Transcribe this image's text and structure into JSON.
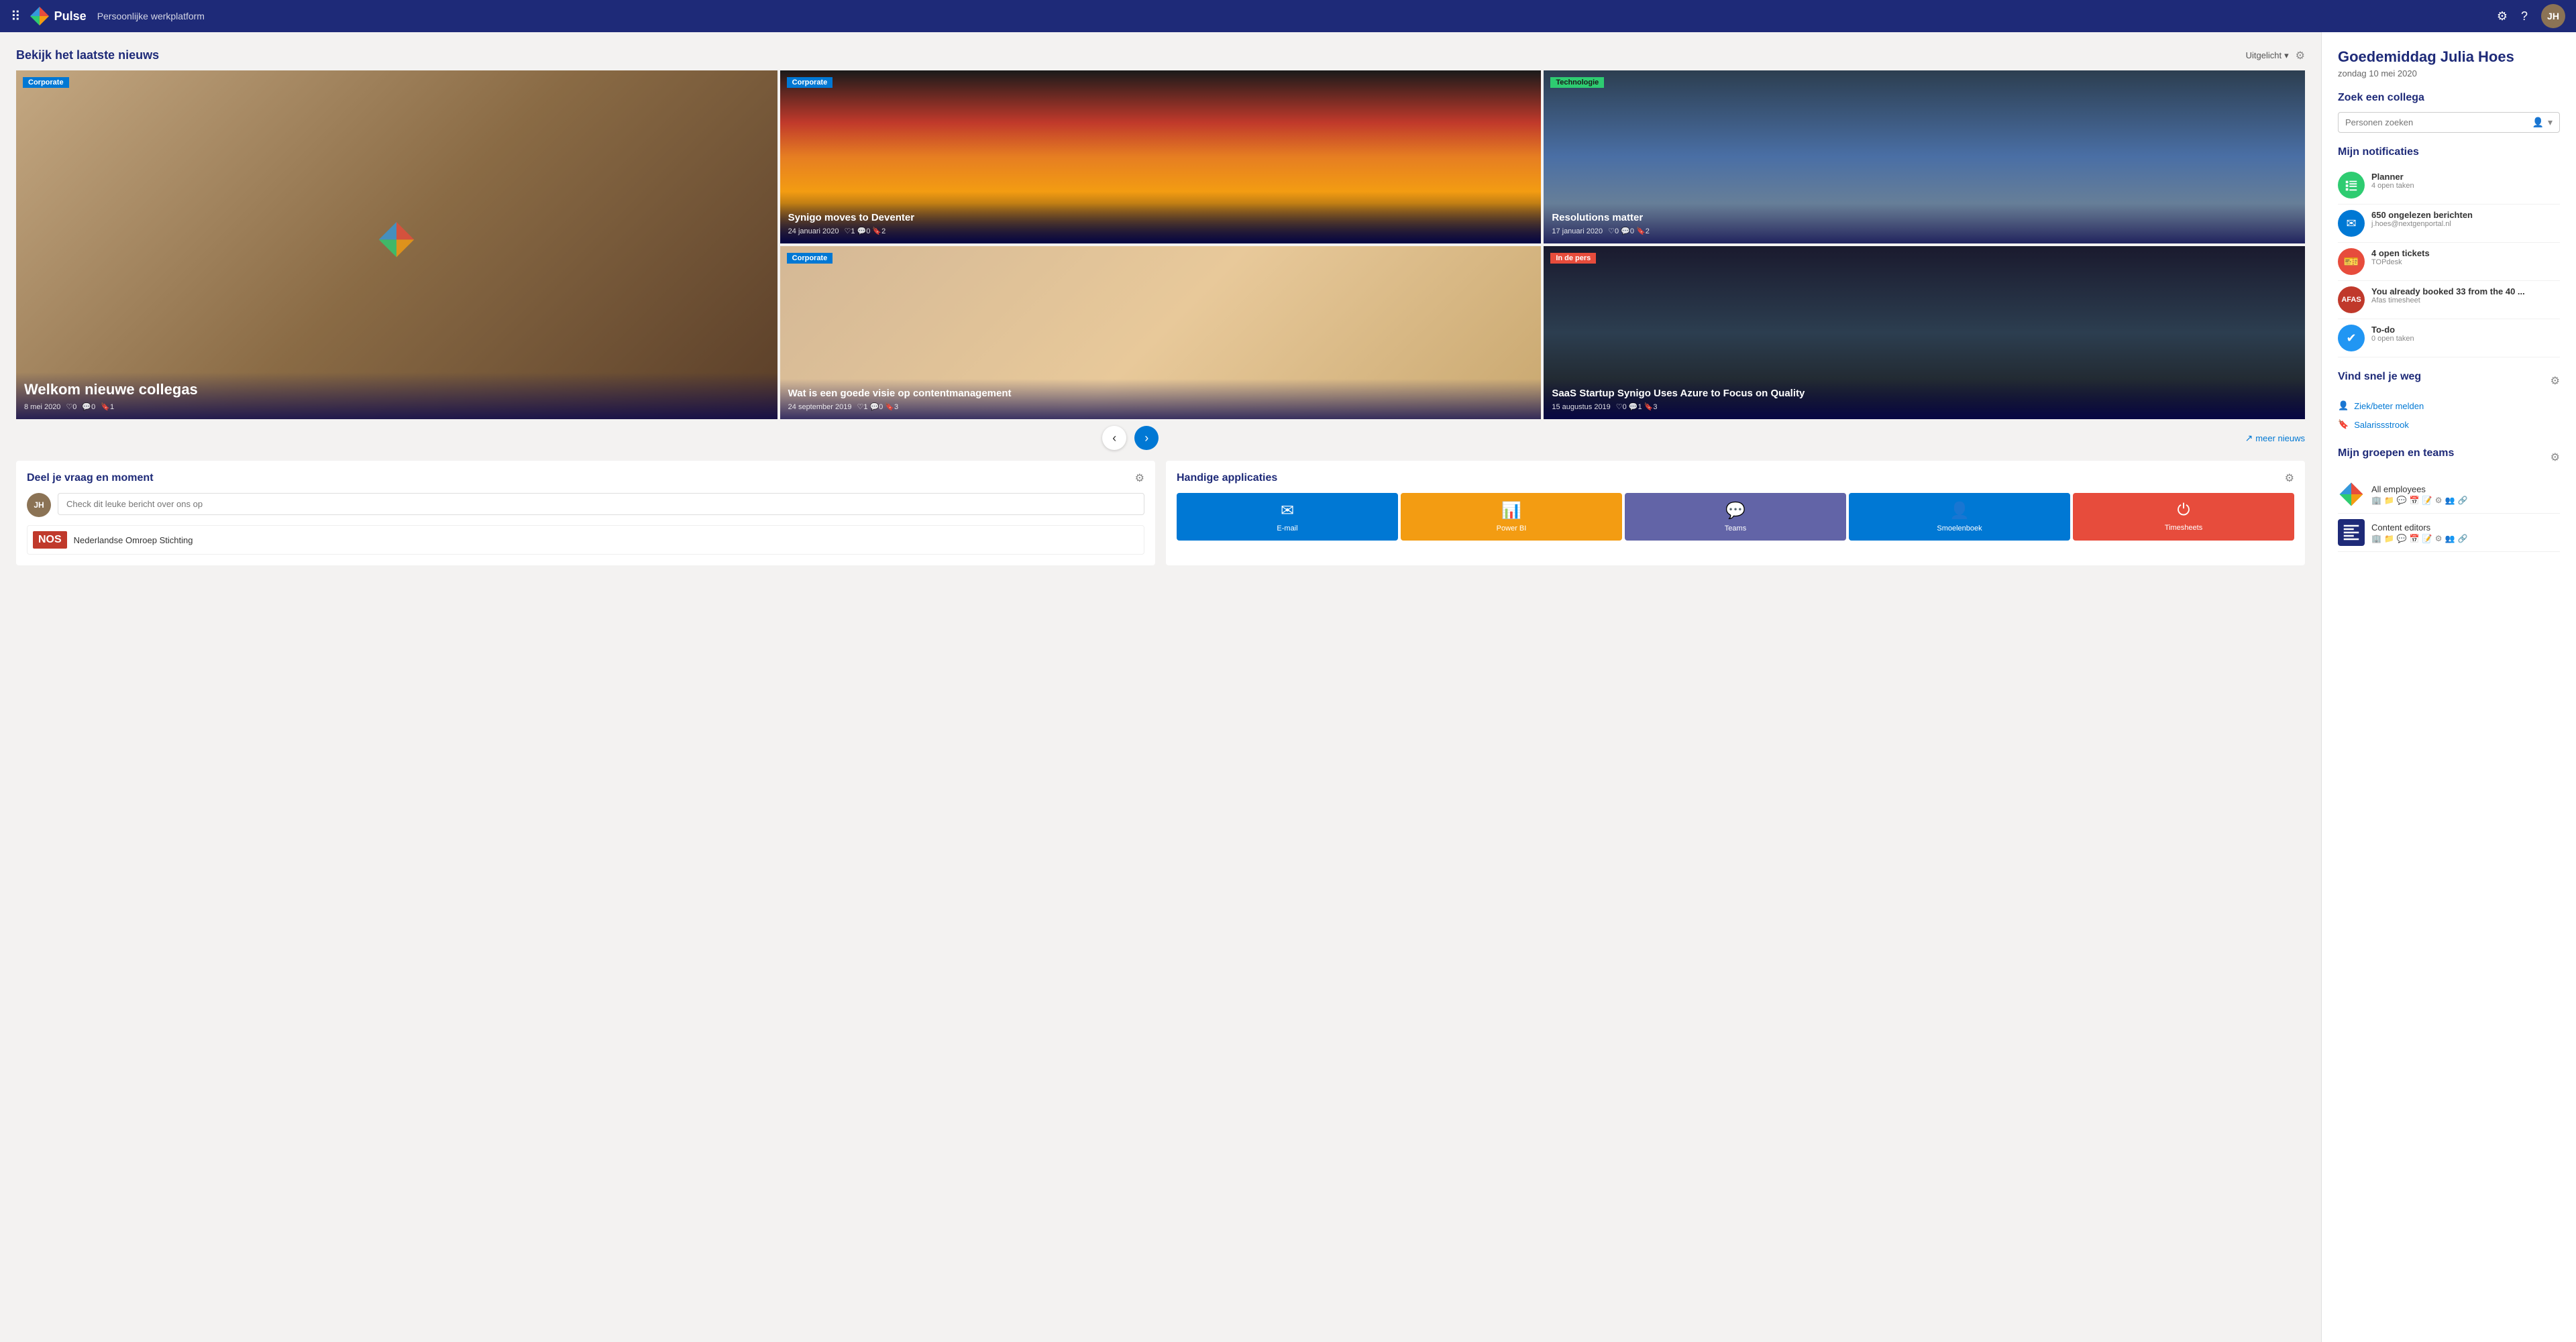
{
  "topnav": {
    "app_name": "Pulse",
    "tagline": "Persoonlijke werkplatform"
  },
  "news_section": {
    "title": "Bekijk het laatste nieuws",
    "filter_label": "Uitgelicht",
    "meer_nieuws": "meer nieuws",
    "articles": [
      {
        "tag": "Corporate",
        "tag_class": "tag-corporate",
        "title": "Welkom nieuwe collegas",
        "date": "8 mei 2020",
        "likes": "0",
        "comments": "0",
        "bookmarks": "1",
        "size": "large",
        "img_class": "img-woman"
      },
      {
        "tag": "Corporate",
        "tag_class": "tag-corporate",
        "title": "Synigo moves to Deventer",
        "date": "24 januari 2020",
        "likes": "1",
        "comments": "0",
        "bookmarks": "2",
        "size": "small",
        "img_class": "img-atrium"
      },
      {
        "tag": "Technologie",
        "tag_class": "tag-tech",
        "title": "Resolutions matter",
        "date": "17 januari 2020",
        "likes": "0",
        "comments": "0",
        "bookmarks": "2",
        "size": "small",
        "img_class": "img-escalator"
      },
      {
        "tag": "Corporate",
        "tag_class": "tag-corporate",
        "title": "Wat is een goede visie op contentmanagement",
        "date": "24 september 2019",
        "likes": "1",
        "comments": "0",
        "bookmarks": "3",
        "size": "small",
        "img_class": "img-hand"
      },
      {
        "tag": "In de pers",
        "tag_class": "tag-pers",
        "title": "SaaS Startup Synigo Uses Azure to Focus on Quality",
        "date": "15 augustus 2019",
        "likes": "0",
        "comments": "1",
        "bookmarks": "3",
        "size": "small",
        "img_class": "img-corridor"
      }
    ]
  },
  "share_panel": {
    "title": "Deel je vraag en moment",
    "placeholder": "Check dit leuke bericht over ons op",
    "nos_label": "NOS",
    "org_name": "Nederlandse Omroep Stichting"
  },
  "apps_panel": {
    "title": "Handige applicaties",
    "apps": [
      {
        "label": "E-mail",
        "icon": "✉",
        "class": "app-email"
      },
      {
        "label": "Power BI",
        "icon": "📊",
        "class": "app-powerbi"
      },
      {
        "label": "Teams",
        "icon": "💬",
        "class": "app-teams"
      },
      {
        "label": "Smoelenboek",
        "icon": "👤",
        "class": "app-smoelenboek"
      },
      {
        "label": "Timesheets",
        "icon": "⏻",
        "class": "app-timesheets"
      }
    ]
  },
  "sidebar": {
    "greeting": "Goedemiddag Julia Hoes",
    "date": "zondag 10 mei 2020",
    "search_title": "Zoek een collega",
    "search_placeholder": "Personen zoeken",
    "notifications_title": "Mijn notificaties",
    "notifications": [
      {
        "icon_class": "notif-planner",
        "icon": "📋",
        "title": "Planner",
        "sub": "4 open taken"
      },
      {
        "icon_class": "notif-email",
        "icon": "✉",
        "title": "650 ongelezen berichten",
        "sub": "j.hoes@nextgenportal.nl"
      },
      {
        "icon_class": "notif-topdesk",
        "icon": "🎫",
        "title": "4 open tickets",
        "sub": "TOPdesk"
      },
      {
        "icon_class": "notif-afas",
        "icon": "A",
        "title": "You already booked 33 from the 40 ...",
        "sub": "Afas timesheet",
        "is_afas": true
      },
      {
        "icon_class": "notif-todo",
        "icon": "✔",
        "title": "To-do",
        "sub": "0 open taken"
      }
    ],
    "quick_links_title": "Vind snel je weg",
    "quick_links": [
      {
        "label": "Ziek/beter melden",
        "icon": "👤"
      },
      {
        "label": "Salarissstrook",
        "icon": "🔖"
      }
    ],
    "groups_title": "Mijn groepen en teams",
    "groups": [
      {
        "name": "All employees",
        "icon": "🏢",
        "is_pulse": true
      },
      {
        "name": "Content editors",
        "icon": "📝"
      }
    ]
  }
}
